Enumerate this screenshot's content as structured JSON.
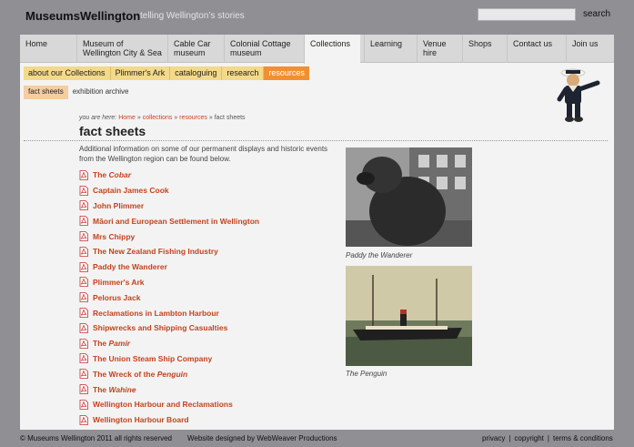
{
  "header": {
    "logo": "MuseumsWellington",
    "tagline": "telling Wellington’s stories",
    "search_placeholder": "",
    "search_label": "search"
  },
  "nav": [
    {
      "label": "Home"
    },
    {
      "label": "Museum of Wellington City & Sea"
    },
    {
      "label": "Cable Car museum"
    },
    {
      "label": "Colonial Cottage museum"
    },
    {
      "label": "Collections"
    },
    {
      "label": "Learning"
    },
    {
      "label": "Venue hire"
    },
    {
      "label": "Shops"
    },
    {
      "label": "Contact us"
    },
    {
      "label": "Join us"
    }
  ],
  "subnav": [
    {
      "label": "about our Collections"
    },
    {
      "label": "Plimmer's Ark"
    },
    {
      "label": "cataloguing"
    },
    {
      "label": "research"
    },
    {
      "label": "resources"
    }
  ],
  "subsub": [
    {
      "label": "fact sheets"
    },
    {
      "label": "exhibition archive"
    }
  ],
  "breadcrumb": {
    "prefix": "you are here:",
    "items": [
      "Home",
      "collections",
      "resources"
    ],
    "current": "fact sheets",
    "sep": " » "
  },
  "title": "fact sheets",
  "intro": "Additional information on some of our permanent displays and historic events from the Wellington region can be found below.",
  "factsheets": [
    {
      "pre": "The ",
      "em": "Cobar",
      "post": ""
    },
    {
      "pre": "Captain James Cook",
      "em": "",
      "post": ""
    },
    {
      "pre": "John Plimmer",
      "em": "",
      "post": ""
    },
    {
      "pre": "Māori and European Settlement in Wellington",
      "em": "",
      "post": ""
    },
    {
      "pre": "Mrs Chippy",
      "em": "",
      "post": ""
    },
    {
      "pre": "The New Zealand Fishing Industry",
      "em": "",
      "post": ""
    },
    {
      "pre": "Paddy the Wanderer",
      "em": "",
      "post": ""
    },
    {
      "pre": "Plimmer's Ark",
      "em": "",
      "post": ""
    },
    {
      "pre": "Pelorus Jack",
      "em": "",
      "post": ""
    },
    {
      "pre": "Reclamations in Lambton Harbour",
      "em": "",
      "post": ""
    },
    {
      "pre": "Shipwrecks and Shipping Casualties",
      "em": "",
      "post": ""
    },
    {
      "pre": "The ",
      "em": "Pamir",
      "post": ""
    },
    {
      "pre": "The Union Steam Ship Company",
      "em": "",
      "post": ""
    },
    {
      "pre": "The Wreck of the ",
      "em": "Penguin",
      "post": ""
    },
    {
      "pre": "The ",
      "em": "Wahine",
      "post": ""
    },
    {
      "pre": "Wellington Harbour and Reclamations",
      "em": "",
      "post": ""
    },
    {
      "pre": "Wellington Harbour Board",
      "em": "",
      "post": ""
    }
  ],
  "photos": [
    {
      "caption": "Paddy the Wanderer"
    },
    {
      "caption": "The Penguin"
    }
  ],
  "footer": {
    "copyright": "© Museums Wellington 2011 all rights reserved",
    "design": "Website designed by WebWeaver Productions",
    "links": [
      "privacy",
      "copyright",
      "terms & conditions"
    ],
    "sep": "|"
  },
  "colors": {
    "link": "#c5421c",
    "subnav": "#f3d98a",
    "subnav_active": "#f09033",
    "background": "#8f8f94"
  }
}
